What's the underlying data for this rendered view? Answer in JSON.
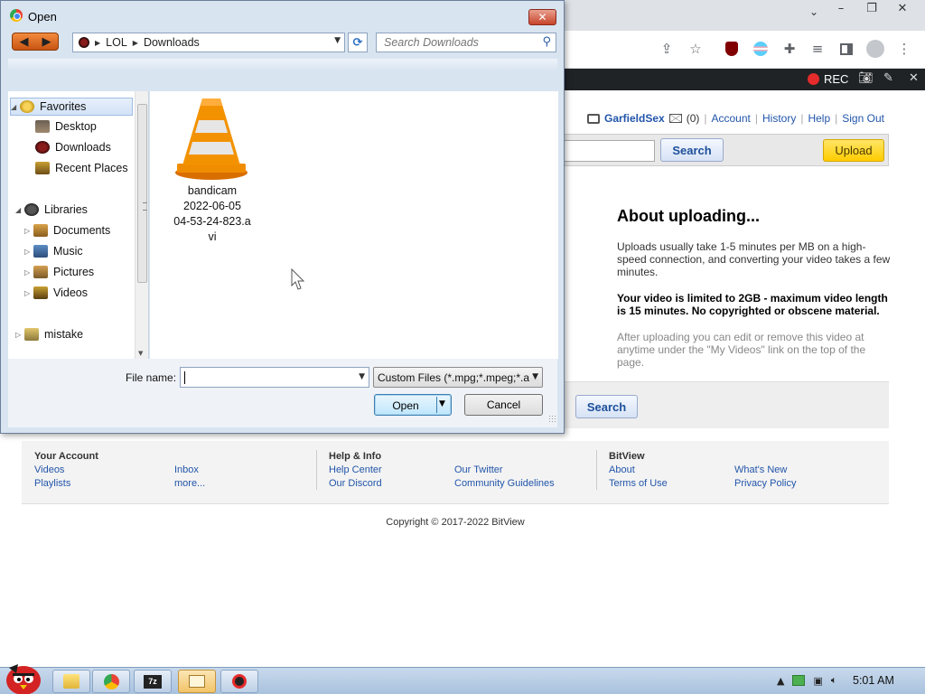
{
  "browser": {
    "window_controls": [
      "–",
      "❐",
      "✕"
    ],
    "tab_dropdown": "⌄",
    "toolbar_icons": [
      "share-icon",
      "star-icon",
      "ublock-icon",
      "extension-icon-flag",
      "puzzle-icon",
      "media-icon",
      "sidepanel-icon",
      "profile-icon",
      "menu-icon"
    ]
  },
  "recorder": {
    "resolution": "1024x635",
    "rec_label": "REC"
  },
  "site": {
    "user": {
      "name": "GarfieldSex",
      "mail_count": "(0)",
      "links": [
        "Account",
        "History",
        "Help",
        "Sign Out"
      ]
    },
    "search_button": "Search",
    "upload_button": "Upload",
    "about": {
      "title": "About uploading...",
      "p1": "Uploads usually take 1-5 minutes per MB on a high-speed connection, and converting your video takes a few minutes.",
      "p2": "Your video is limited to 2GB - maximum video length is 15 minutes. No copyrighted or obscene material.",
      "p3": "After uploading you can edit or remove this video at anytime under the \"My Videos\" link on the top of the page."
    },
    "search_button_2": "Search",
    "footer": {
      "col1": {
        "heading": "Your Account",
        "links_a": [
          "Videos",
          "Playlists"
        ],
        "links_b": [
          "Inbox",
          "more..."
        ]
      },
      "col2": {
        "heading": "Help & Info",
        "links_a": [
          "Help Center",
          "Our Discord"
        ],
        "links_b": [
          "Our Twitter",
          "Community Guidelines"
        ]
      },
      "col3": {
        "heading": "BitView",
        "links_a": [
          "About",
          "Terms of Use"
        ],
        "links_b": [
          "What's New",
          "Privacy Policy"
        ]
      }
    },
    "copyright": "Copyright © 2017-2022 BitView"
  },
  "dialog": {
    "title": "Open",
    "close": "✕",
    "breadcrumb": [
      "LOL",
      "Downloads"
    ],
    "search_placeholder": "Search Downloads",
    "nav": {
      "favorites": "Favorites",
      "fav_items": [
        "Desktop",
        "Downloads",
        "Recent Places"
      ],
      "libraries": "Libraries",
      "lib_items": [
        "Documents",
        "Music",
        "Pictures",
        "Videos"
      ],
      "other": "mistake"
    },
    "file": {
      "name_lines": [
        "bandicam",
        "2022-06-05",
        "04-53-24-823.a",
        "vi"
      ]
    },
    "file_name_label": "File name:",
    "file_name_value": "",
    "filter": "Custom Files (*.mpg;*.mpeg;*.a",
    "open_button": "Open",
    "cancel_button": "Cancel"
  },
  "taskbar": {
    "clock": "5:01 AM",
    "apps": [
      "explorer-icon",
      "chrome-icon",
      "7zip-icon",
      "folder-window-icon",
      "bandicam-icon"
    ]
  },
  "colors": {
    "link_blue": "#2255aa",
    "upload_yellow": "#ffcc00",
    "rec_red": "#e52b2b",
    "vlc_orange": "#f08c00"
  }
}
